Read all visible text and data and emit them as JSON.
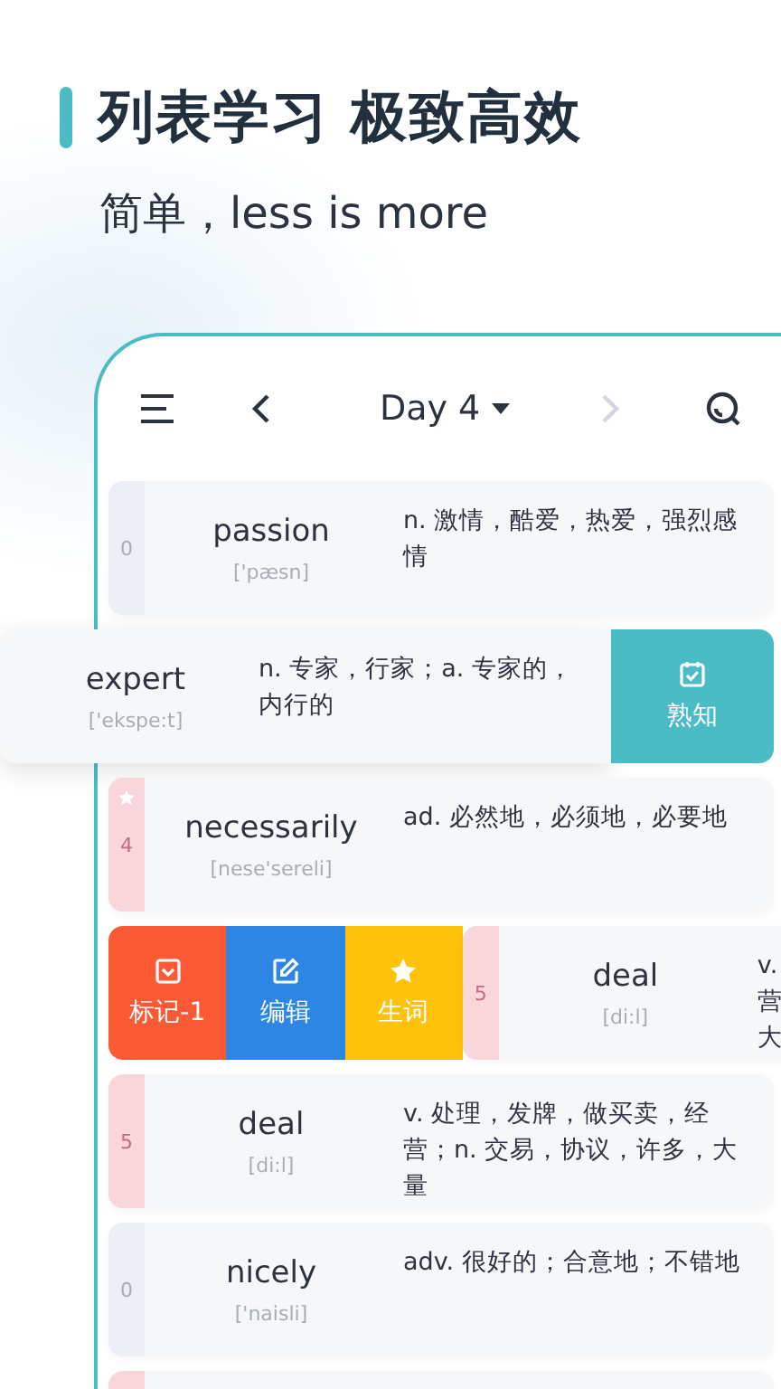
{
  "headline": {
    "title": "列表学习 极致高效",
    "subtitle": "简单，less is more"
  },
  "header": {
    "title": "Day 4",
    "next_disabled": true
  },
  "rows": [
    {
      "word": "passion",
      "phonetic": "['pæsn]",
      "meaning": "n. 激情，酷爱，热爱，强烈感情",
      "count": "0",
      "color": "#eceff3",
      "starred": false,
      "kind": "plain",
      "actions": []
    },
    {
      "word": "expert",
      "phonetic": "['ekspe:t]",
      "meaning": "n. 专家，行家；a. 专家的，内行的",
      "kind": "swiped_left",
      "actions": [
        {
          "label": "熟知",
          "kind": "known",
          "color": "#4bbcc6"
        }
      ]
    },
    {
      "word": "necessarily",
      "phonetic": "[nese'sereli]",
      "meaning": "ad. 必然地，必须地，必要地",
      "count": "4",
      "color": "#f9d5dc",
      "starred": true,
      "kind": "plain",
      "actions": []
    },
    {
      "word": "deal",
      "phonetic": "[di:l]",
      "meaning": "v.营大",
      "count": "5",
      "color": "#f9d5dc",
      "starred": false,
      "kind": "swiped_right",
      "actions": [
        {
          "label": "标记-1",
          "kind": "mark",
          "color": "#fc5a35"
        },
        {
          "label": "编辑",
          "kind": "edit",
          "color": "#2d85e4"
        },
        {
          "label": "生词",
          "kind": "star",
          "color": "#fec20b"
        }
      ]
    },
    {
      "word": "deal",
      "phonetic": "[di:l]",
      "meaning": "v. 处理，发牌，做买卖，经营；n. 交易，协议，许多，大量",
      "count": "5",
      "color": "#f9d5dc",
      "starred": false,
      "kind": "plain",
      "actions": []
    },
    {
      "word": "nicely",
      "phonetic": "['naisli]",
      "meaning": "adv. 很好的；合意地；不错地",
      "count": "0",
      "color": "#eceff3",
      "starred": false,
      "kind": "plain",
      "actions": []
    },
    {
      "color": "#f9d5dc",
      "starred": false,
      "kind": "plain",
      "actions": []
    }
  ]
}
